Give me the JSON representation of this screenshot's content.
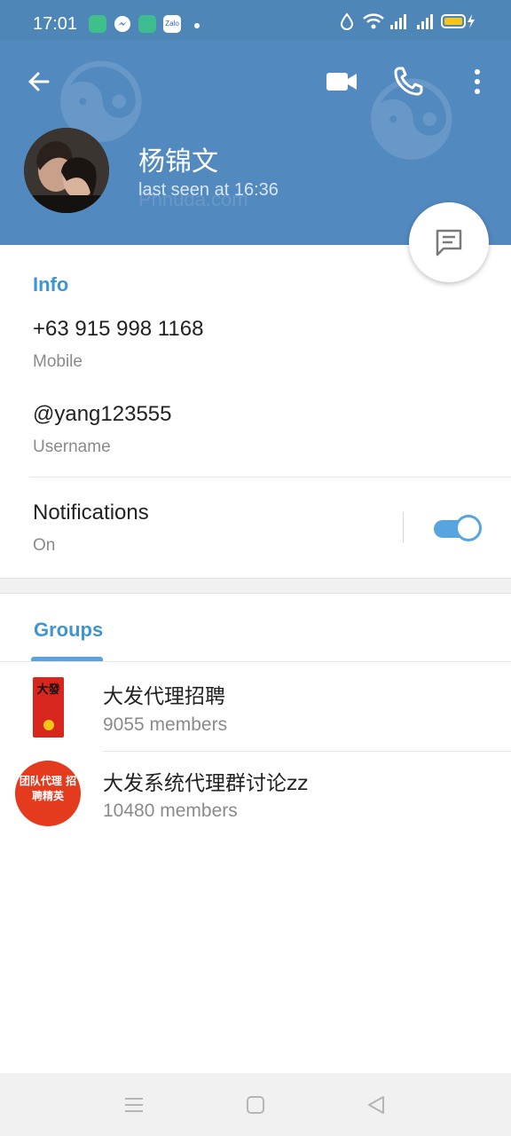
{
  "status_bar": {
    "time": "17:01",
    "apps": [
      "notes-app",
      "messenger-app",
      "app-icon",
      "Zalo"
    ]
  },
  "header": {
    "name": "杨锦文",
    "last_seen": "last seen at 16:36",
    "watermark_text": "Phhuda.com",
    "color": "#5289bf"
  },
  "info": {
    "title": "Info",
    "phone": "+63 915 998 1168",
    "phone_label": "Mobile",
    "username": "@yang123555",
    "username_label": "Username",
    "notifications_label": "Notifications",
    "notifications_state": "On",
    "notifications_on": true
  },
  "groups": {
    "title": "Groups",
    "items": [
      {
        "name": "大发代理招聘",
        "members": "9055 members",
        "avatar_text": "大發"
      },
      {
        "name": "大发系统代理群讨论zz",
        "members": "10480 members",
        "avatar_text": "团队代理 招聘精英"
      }
    ]
  },
  "colors": {
    "accent": "#3e95d1",
    "header": "#5289bf",
    "toggle": "#57a4df"
  }
}
